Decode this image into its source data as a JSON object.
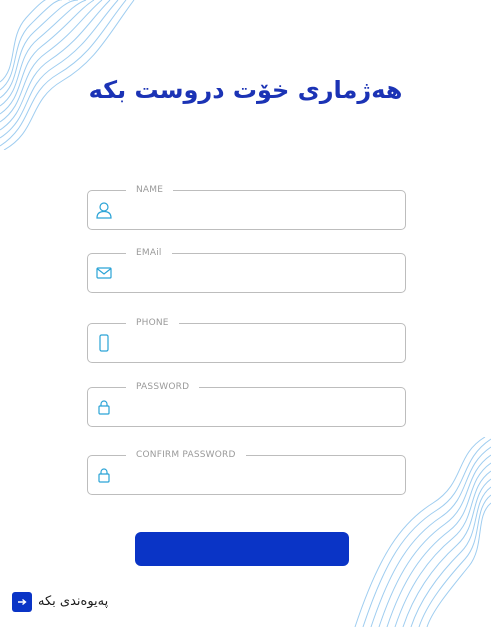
{
  "page": {
    "title": "هەژماری خۆت دروست بکە"
  },
  "form": {
    "fields": [
      {
        "label": "NAME",
        "icon": "user-icon",
        "value": ""
      },
      {
        "label": "EMAil",
        "icon": "mail-icon",
        "value": ""
      },
      {
        "label": "PHONE",
        "icon": "phone-icon",
        "value": ""
      },
      {
        "label": "PASSWORD",
        "icon": "lock-icon",
        "value": ""
      },
      {
        "label": "CONFIRM PASSWORD",
        "icon": "lock-icon",
        "value": ""
      }
    ],
    "submit_label": ""
  },
  "footer": {
    "contact_label": "پەیوەندی بکە",
    "contact_icon": "arrow-right-icon"
  },
  "colors": {
    "accent": "#0a34c6",
    "title": "#1b33b5",
    "icon": "#2aa3d6",
    "border": "#bdbdbd",
    "label": "#9a9a9a",
    "wave": "#9fcdf0"
  }
}
